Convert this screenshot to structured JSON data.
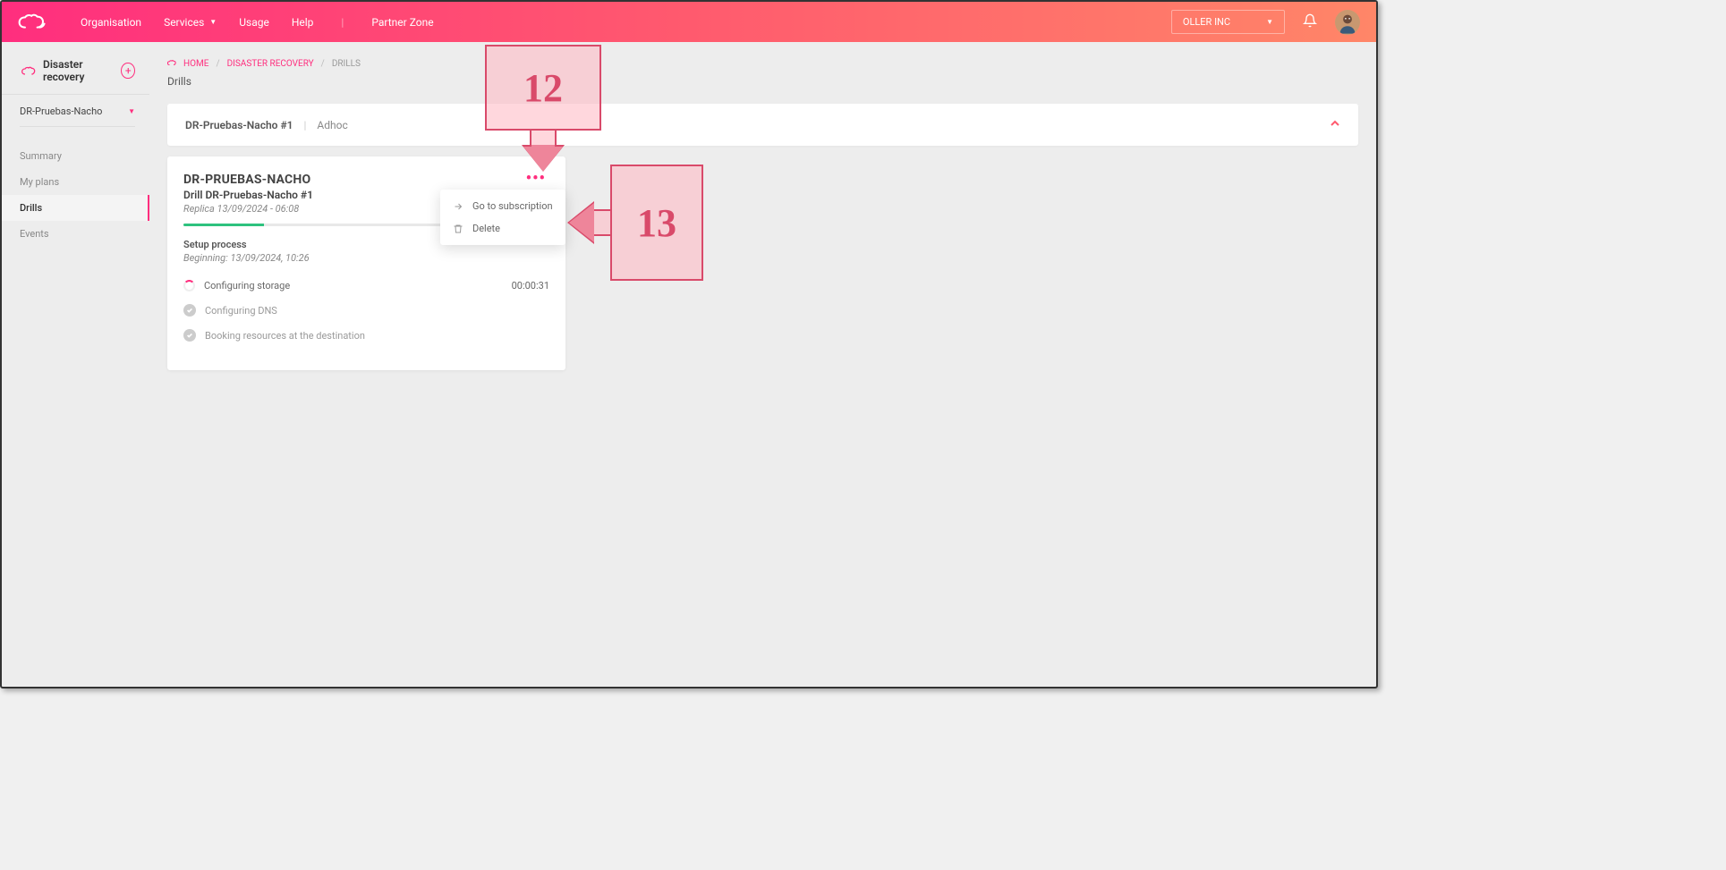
{
  "topbar": {
    "nav": {
      "organisation": "Organisation",
      "services": "Services",
      "usage": "Usage",
      "help": "Help",
      "partner_zone": "Partner Zone"
    },
    "org_selector": "OLLER INC"
  },
  "sidebar": {
    "heading": "Disaster recovery",
    "selector": "DR-Pruebas-Nacho",
    "items": [
      {
        "label": "Summary"
      },
      {
        "label": "My plans"
      },
      {
        "label": "Drills"
      },
      {
        "label": "Events"
      }
    ],
    "active_index": 2
  },
  "breadcrumb": {
    "home": "HOME",
    "section": "DISASTER RECOVERY",
    "current": "DRILLS"
  },
  "page": {
    "title": "Drills"
  },
  "panel": {
    "name": "DR-Pruebas-Nacho #1",
    "tag": "Adhoc"
  },
  "card": {
    "title": "DR-PRUEBAS-NACHO",
    "subtitle": "Drill DR-Pruebas-Nacho #1",
    "replica": "Replica 13/09/2024 - 06:08",
    "setup_title": "Setup process",
    "setup_meta": "Beginning: 13/09/2024, 10:26",
    "steps": [
      {
        "label": "Configuring storage",
        "state": "running",
        "time": "00:00:31"
      },
      {
        "label": "Configuring DNS",
        "state": "idle",
        "time": ""
      },
      {
        "label": "Booking resources at the destination",
        "state": "idle",
        "time": ""
      }
    ],
    "menu": {
      "go_to_subscription": "Go to subscription",
      "delete": "Delete"
    }
  },
  "annotations": {
    "c12": "12",
    "c13": "13"
  }
}
